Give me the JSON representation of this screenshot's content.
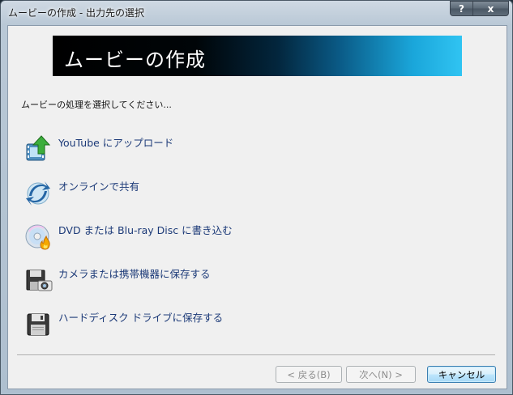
{
  "window": {
    "title": "ムービーの作成 - 出力先の選択",
    "help_label": "?",
    "close_label": "x"
  },
  "banner": {
    "title": "ムービーの作成"
  },
  "instruction": "ムービーの処理を選択してください...",
  "options": [
    {
      "label": "YouTube にアップロード",
      "icon": "film-upload-icon"
    },
    {
      "label": "オンラインで共有",
      "icon": "share-online-icon"
    },
    {
      "label": "DVD または Blu-ray Disc に書き込む",
      "icon": "disc-burn-icon"
    },
    {
      "label": "カメラまたは携帯機器に保存する",
      "icon": "camera-save-icon"
    },
    {
      "label": "ハードディスク ドライブに保存する",
      "icon": "floppy-save-icon"
    }
  ],
  "buttons": {
    "back": "< 戻る(B)",
    "next": "次へ(N) >",
    "cancel": "キャンセル"
  },
  "colors": {
    "link_text": "#1c3a78",
    "banner_gradient_end": "#30c4f2"
  }
}
